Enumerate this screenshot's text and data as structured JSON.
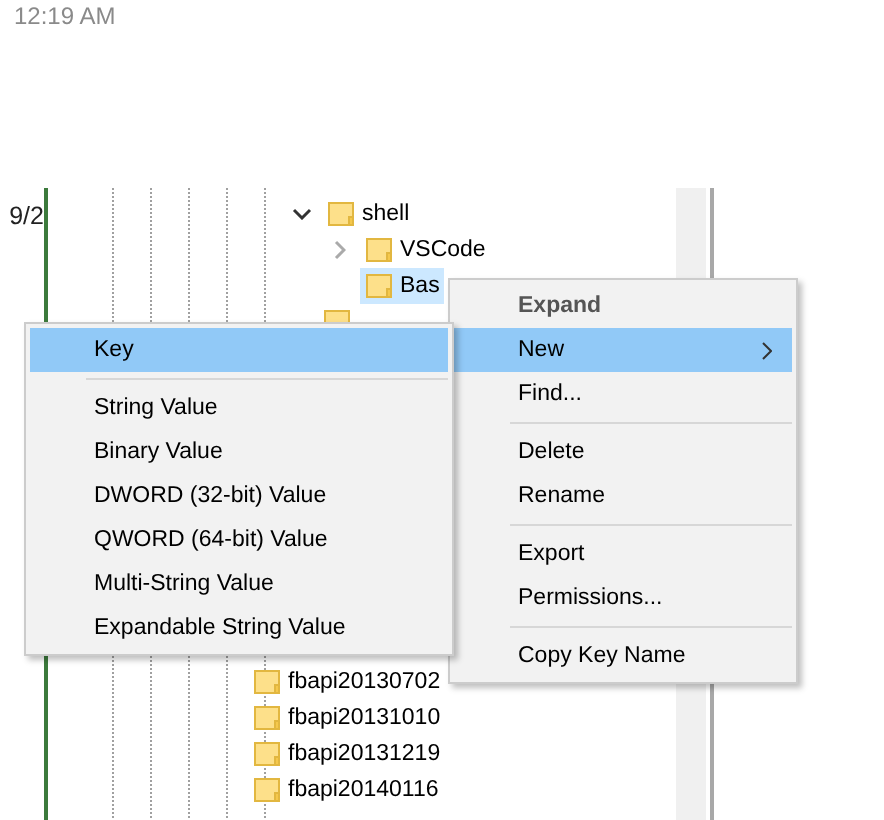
{
  "timestamp": "12:19 AM",
  "left_column": {
    "text": "9/2"
  },
  "tree": {
    "upper": [
      {
        "label": "shell",
        "expanded": true,
        "children": [
          {
            "label": "VSCode",
            "expanded": false
          },
          {
            "label": "Bas",
            "selected": true
          }
        ]
      },
      {
        "kind": "folder-only"
      }
    ],
    "lower": [
      {
        "label": "fbapi20130702",
        "selected": false
      },
      {
        "label": "fbapi20131010",
        "selected": false
      },
      {
        "label": "fbapi20131219",
        "selected": false
      },
      {
        "label": "fbapi20140116",
        "selected": false
      }
    ]
  },
  "context_menu": {
    "items": [
      {
        "kind": "item",
        "label": "Expand",
        "default": true,
        "selected": false
      },
      {
        "kind": "item",
        "label": "New",
        "submenu": true,
        "selected": true
      },
      {
        "kind": "item",
        "label": "Find...",
        "selected": false
      },
      {
        "kind": "separator"
      },
      {
        "kind": "item",
        "label": "Delete",
        "selected": false
      },
      {
        "kind": "item",
        "label": "Rename",
        "selected": false
      },
      {
        "kind": "separator"
      },
      {
        "kind": "item",
        "label": "Export",
        "selected": false
      },
      {
        "kind": "item",
        "label": "Permissions...",
        "selected": false
      },
      {
        "kind": "separator"
      },
      {
        "kind": "item",
        "label": "Copy Key Name",
        "selected": false
      }
    ]
  },
  "submenu": {
    "items": [
      {
        "kind": "item",
        "label": "Key",
        "selected": true
      },
      {
        "kind": "separator"
      },
      {
        "kind": "item",
        "label": "String Value",
        "selected": false
      },
      {
        "kind": "item",
        "label": "Binary Value",
        "selected": false
      },
      {
        "kind": "item",
        "label": "DWORD (32-bit) Value",
        "selected": false
      },
      {
        "kind": "item",
        "label": "QWORD (64-bit) Value",
        "selected": false
      },
      {
        "kind": "item",
        "label": "Multi-String Value",
        "selected": false
      },
      {
        "kind": "item",
        "label": "Expandable String Value",
        "selected": false
      }
    ]
  }
}
